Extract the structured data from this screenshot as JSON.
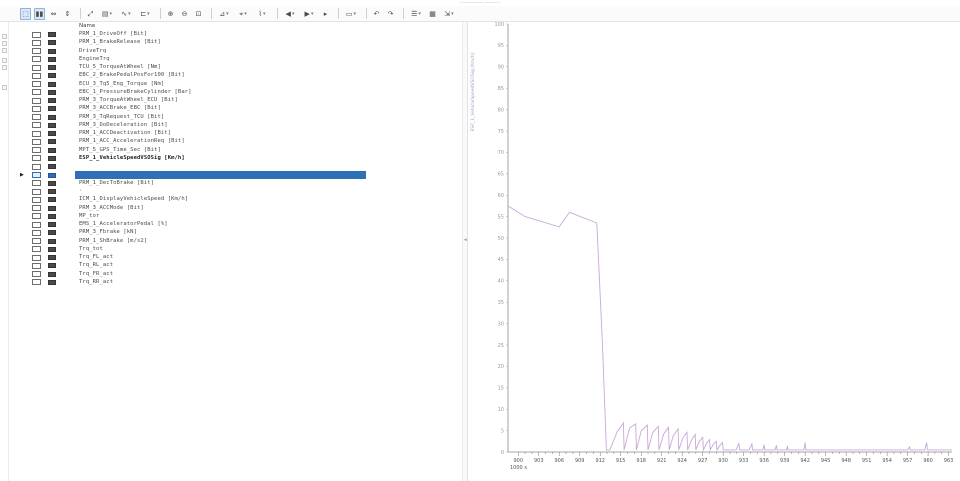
{
  "titlebar": {
    "text": "—————— ————"
  },
  "toolbar": {
    "buttons": [
      {
        "name": "select-cursor-button",
        "glyph": "⬚",
        "active": true
      },
      {
        "name": "marker-button",
        "glyph": "▮▮",
        "active": true
      },
      {
        "name": "zoom-x-button",
        "glyph": "⇔"
      },
      {
        "name": "zoom-y-button",
        "glyph": "⇕"
      },
      {
        "name": "sep"
      },
      {
        "name": "fit-button",
        "glyph": "⤢"
      },
      {
        "name": "layout-button",
        "glyph": "▤",
        "dropdown": true
      },
      {
        "name": "line-style-button",
        "glyph": "∿",
        "dropdown": true
      },
      {
        "name": "axis-button",
        "glyph": "⊏",
        "dropdown": true
      },
      {
        "name": "sep"
      },
      {
        "name": "zoom-in-button",
        "glyph": "⊕"
      },
      {
        "name": "zoom-out-button",
        "glyph": "⊖"
      },
      {
        "name": "zoom-box-button",
        "glyph": "⊡"
      },
      {
        "name": "sep"
      },
      {
        "name": "cursor-mode-button",
        "glyph": "⊿",
        "dropdown": true
      },
      {
        "name": "measure-button",
        "glyph": "⌖",
        "dropdown": true
      },
      {
        "name": "trace-button",
        "glyph": "⌇",
        "dropdown": true
      },
      {
        "name": "sep"
      },
      {
        "name": "step-back-button",
        "glyph": "◀",
        "dropdown": true
      },
      {
        "name": "play-button",
        "glyph": "▶",
        "dropdown": true
      },
      {
        "name": "step-forward-button",
        "glyph": "▸"
      },
      {
        "name": "sep"
      },
      {
        "name": "display-button",
        "glyph": "▭",
        "dropdown": true
      },
      {
        "name": "sep"
      },
      {
        "name": "undo-button",
        "glyph": "↶"
      },
      {
        "name": "redo-button",
        "glyph": "↷"
      },
      {
        "name": "sep"
      },
      {
        "name": "list-button",
        "glyph": "☰",
        "dropdown": true
      },
      {
        "name": "table-button",
        "glyph": "▦"
      },
      {
        "name": "export-button",
        "glyph": "⇲",
        "dropdown": true
      }
    ]
  },
  "signal_list": {
    "column_header": "Name",
    "selected_index": 19,
    "items": [
      "PRM_1_DriveOff [Bit]",
      "PRM_1_BrakeRelease [Bit]",
      "DriveTrq",
      "EngineTrq",
      "TCU_5_TorqueAtWheel [Nm]",
      "EBC_2_BrakePedalPosFor100 [Bit]",
      "ECU_3_Tq5_Eng_Torque [Nm]",
      "EBC_1_PressureBrakeCylinder [Bar]",
      "PRM_3_TorqueAtWheel_ECU [Bit]",
      "PRM_3_ACCBrake_EBC [Bit]",
      "PRM_3_TqRequest_TCU [Bit]",
      "PRM_3_DoDeceleration [Bit]",
      "PRM_1_ACCDeactivation [Bit]",
      "PRM_1_ACC_AccelerationReq [Bit]",
      "MPT_5_GPS_Time_Sec [Bit]",
      "ESP_1_VehicleSpeedVSOSig [Km/h]",
      "",
      "",
      "PRM_1_DecToBrake [Bit]",
      "",
      "ICM_1_DisplayVehicleSpeed [Km/h]",
      "PRM_3_ACCMode [Bit]",
      "MP_tor",
      "EMS_1_AcceleratorPedal [%]",
      "PRM_3_Fbrake [kN]",
      "PRM_1_ShBrake [m/s2]",
      "Trq_tot",
      "Trq_FL_act",
      "Trq_RL_act",
      "Trq_FR_act",
      "Trq_RR_act"
    ],
    "bold_indices": [
      15
    ],
    "arrow_index": 17,
    "dot_index": 19
  },
  "chart_data": {
    "type": "line",
    "title": "",
    "ylabel": "ESP_1_VehicleSpeedVSOSig [Km/h]",
    "xlabel": "",
    "x_exponent_label": "1000 s",
    "xlim": [
      898.5,
      963.5
    ],
    "ylim": [
      0,
      100
    ],
    "y_ticks": [
      0,
      5,
      10,
      15,
      20,
      25,
      30,
      35,
      40,
      45,
      50,
      55,
      60,
      65,
      70,
      75,
      80,
      85,
      90,
      95,
      100
    ],
    "x_ticks": [
      900,
      903,
      906,
      909,
      912,
      915,
      918,
      921,
      924,
      927,
      930,
      933,
      936,
      939,
      942,
      945,
      948,
      951,
      954,
      957,
      960,
      963
    ],
    "series": [
      {
        "name": "ESP_1_VehicleSpeedVSOSig",
        "color": "#c8a8d8",
        "x": [
          898.5,
          901,
          906,
          907.5,
          911.5,
          912.3,
          912.9,
          913.4,
          914.5,
          915.4,
          915.5,
          916.3,
          917.2,
          917.3,
          918,
          918.9,
          919,
          919.7,
          920.5,
          920.6,
          921.3,
          922,
          922.1,
          922.7,
          923.4,
          923.5,
          924.1,
          924.7,
          924.8,
          925.4,
          925.9,
          926,
          926.5,
          927,
          927.1,
          927.6,
          928,
          928.1,
          928.6,
          929,
          929.1,
          929.6,
          929.9,
          930,
          931.9,
          932.3,
          932.4,
          933.8,
          934.2,
          934.3,
          935.8,
          936,
          936.1,
          937.6,
          937.8,
          937.9,
          939.3,
          939.4,
          939.5,
          941.8,
          942,
          942.1,
          957,
          957.3,
          957.4,
          959.5,
          959.8,
          959.9,
          963.5
        ],
        "y": [
          57.5,
          55,
          52.6,
          56,
          53.5,
          26,
          0.5,
          0.5,
          4.8,
          6.8,
          0.5,
          5.6,
          6.6,
          0.5,
          4.9,
          6.3,
          0.5,
          4.6,
          6.0,
          0.5,
          4.2,
          5.8,
          0.5,
          3.8,
          5.4,
          0.5,
          3.3,
          4.6,
          0.5,
          2.9,
          4.1,
          0.5,
          2.5,
          3.4,
          0.5,
          2.1,
          2.9,
          0.5,
          1.9,
          2.5,
          0.5,
          1.7,
          2.2,
          0.5,
          0.5,
          2.1,
          0.5,
          0.5,
          1.9,
          0.5,
          0.5,
          1.7,
          0.5,
          0.5,
          1.6,
          0.5,
          0.5,
          1.4,
          0.5,
          0.5,
          2.2,
          0.5,
          0.5,
          1.2,
          0.5,
          0.5,
          2.2,
          0.5,
          0.5
        ]
      }
    ],
    "grid": false,
    "legend": "none"
  },
  "colors": {
    "selection": "#2f6fb8",
    "series": "#c8a8d8",
    "axis": "#8a8a8a"
  }
}
